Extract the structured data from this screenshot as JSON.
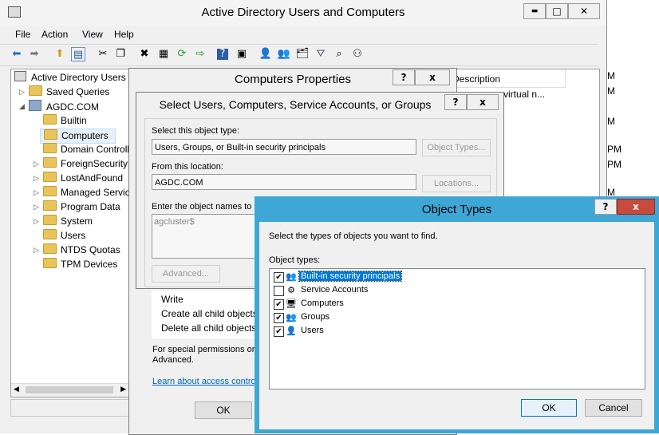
{
  "main_window": {
    "title": "Active Directory Users and Computers",
    "menu": [
      "File",
      "Action",
      "View",
      "Help"
    ],
    "tree_root": "Active Directory Users a",
    "tree": [
      {
        "label": "Saved Queries",
        "expander": "▷"
      },
      {
        "label": "AGDC.COM",
        "expander": "◢"
      },
      {
        "label": "Builtin",
        "expander": ""
      },
      {
        "label": "Computers",
        "expander": ""
      },
      {
        "label": "Domain Controll",
        "expander": ""
      },
      {
        "label": "ForeignSecurityP",
        "expander": "▷"
      },
      {
        "label": "LostAndFound",
        "expander": "▷"
      },
      {
        "label": "Managed Service",
        "expander": "▷"
      },
      {
        "label": "Program Data",
        "expander": "▷"
      },
      {
        "label": "System",
        "expander": "▷"
      },
      {
        "label": "Users",
        "expander": ""
      },
      {
        "label": "NTDS Quotas",
        "expander": "▷"
      },
      {
        "label": "TPM Devices",
        "expander": ""
      }
    ],
    "list_header_description": "Description",
    "list_row_description": "er virtual n...",
    "right_fragments": [
      "M",
      "M",
      "M",
      "PM",
      "PM",
      "M"
    ]
  },
  "computers_properties": {
    "title": "Computers Properties",
    "help": "?",
    "close": "x",
    "permissions": [
      "Write",
      "Create all child objects",
      "Delete all child objects"
    ],
    "special_text_1": "For special permissions or ac",
    "special_text_2": "Advanced.",
    "learn_link": "Learn about access control",
    "ok": "OK"
  },
  "select_dialog": {
    "title": "Select Users, Computers, Service Accounts, or Groups",
    "help": "?",
    "close": "x",
    "object_type_label": "Select this object type:",
    "object_type_value": "Users, Groups, or Built-in security principals",
    "object_types_button": "Object Types...",
    "location_label": "From this location:",
    "location_value": "AGDC.COM",
    "locations_button": "Locations...",
    "names_label": "Enter the object names to se",
    "names_value": "agcluster$",
    "advanced_button": "Advanced..."
  },
  "object_types": {
    "title": "Object Types",
    "help": "?",
    "close": "x",
    "instruction": "Select the types of objects you want to find.",
    "list_label": "Object types:",
    "items": [
      {
        "label": "Built-in security principals",
        "checked": "✔",
        "icon": "👥"
      },
      {
        "label": "Service Accounts",
        "checked": "",
        "icon": "⚙"
      },
      {
        "label": "Computers",
        "checked": "✔",
        "icon": "🖥"
      },
      {
        "label": "Groups",
        "checked": "✔",
        "icon": "👥"
      },
      {
        "label": "Users",
        "checked": "✔",
        "icon": "👤"
      }
    ],
    "ok": "OK",
    "cancel": "Cancel"
  },
  "window_controls": {
    "minimize": "▬",
    "maximize": "□",
    "close": "✕"
  }
}
